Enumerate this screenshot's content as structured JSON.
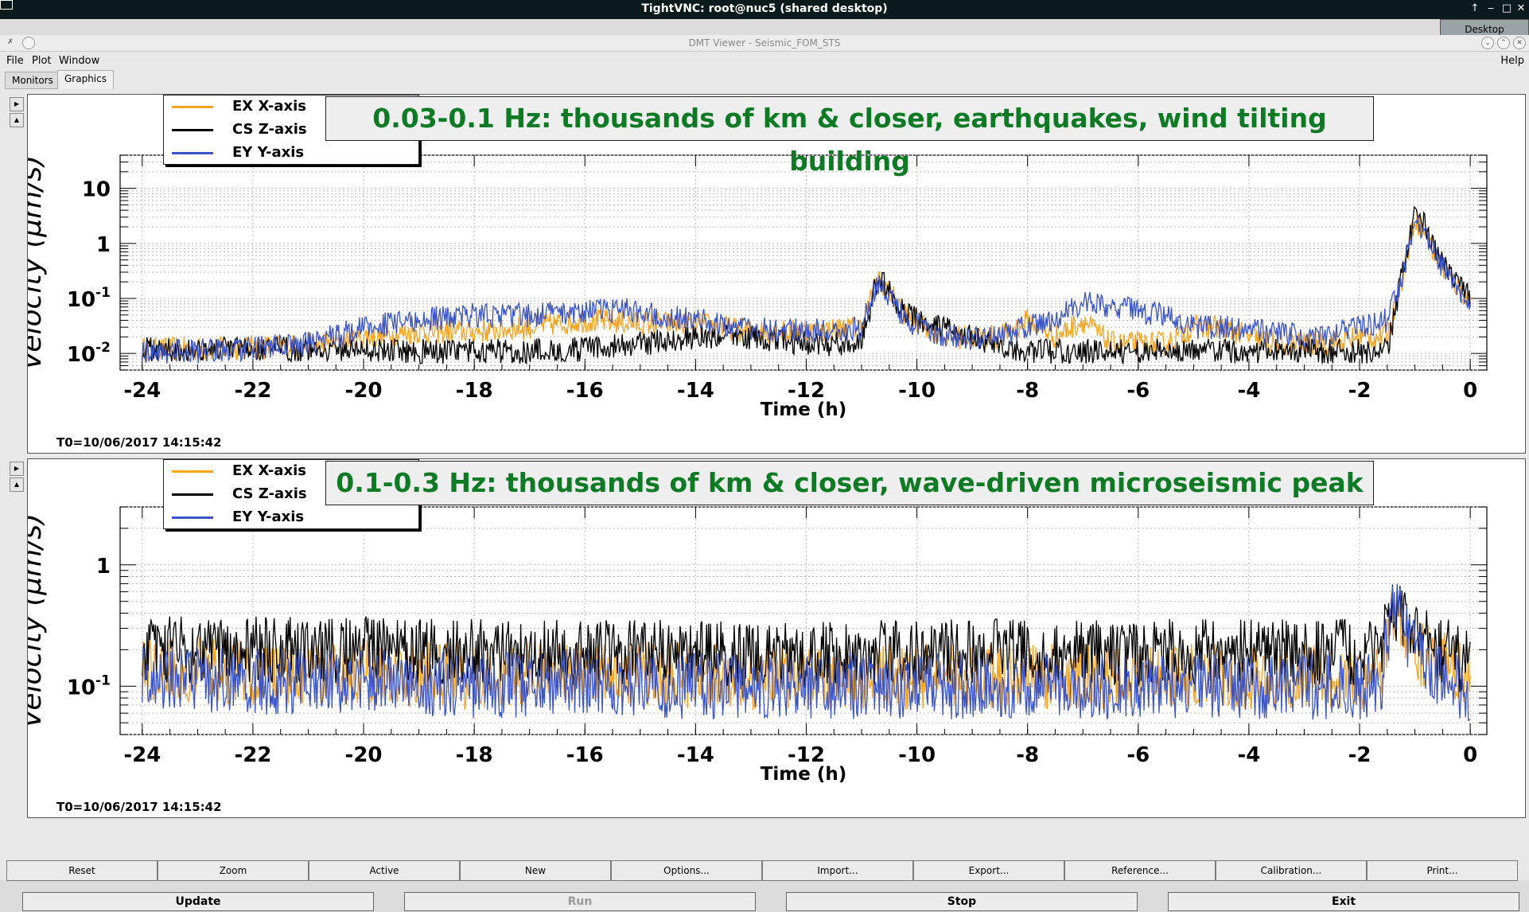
{
  "vnc": {
    "title": "TightVNC: root@nuc5 (shared desktop)",
    "desktop_tab": "Desktop"
  },
  "app": {
    "title": "DMT Viewer - Seismic_FOM_STS"
  },
  "menu": {
    "file": "File",
    "plot": "Plot",
    "window": "Window",
    "help": "Help"
  },
  "tabs": {
    "monitors": "Monitors",
    "graphics": "Graphics"
  },
  "legend": {
    "ex": "EX X-axis",
    "cs": "CS Z-axis",
    "ey": "EY Y-axis"
  },
  "colors": {
    "ex": "#f5a51c",
    "cs": "#000000",
    "ey": "#3b55c8",
    "title_green": "#0d7a24"
  },
  "plot1": {
    "title": "0.03-0.1 Hz: thousands of km & closer, earthquakes, wind tilting building",
    "t0": "T0=10/06/2017 14:15:42"
  },
  "plot2": {
    "title": "0.1-0.3 Hz: thousands of km & closer, wave-driven microseismic peak",
    "t0": "T0=10/06/2017 14:15:42"
  },
  "chart_data": [
    {
      "type": "line",
      "title": "0.03-0.1 Hz: thousands of km & closer, earthquakes, wind tilting building",
      "xlabel": "Time (h)",
      "ylabel": "Velocity  (μm/s)",
      "yscale": "log",
      "xlim": [
        -24.4,
        0.3
      ],
      "ylim": [
        0.005,
        40
      ],
      "xticks": [
        "-24",
        "-22",
        "-20",
        "-18",
        "-16",
        "-14",
        "-12",
        "-10",
        "-8",
        "-6",
        "-4",
        "-2",
        "0"
      ],
      "yticks": [
        {
          "v": 0.01,
          "base": "10",
          "exp": "-2"
        },
        {
          "v": 0.1,
          "base": "10",
          "exp": "-1"
        },
        {
          "v": 1,
          "base": "1",
          "exp": ""
        },
        {
          "v": 10,
          "base": "10",
          "exp": ""
        }
      ],
      "legend": "top-left",
      "grid": true,
      "series": [
        {
          "name": "EX X-axis",
          "color": "#f5a51c",
          "x": [
            -24,
            -23,
            -22,
            -21,
            -20,
            -19,
            -18,
            -17,
            -16,
            -15,
            -14,
            -13,
            -12,
            -11,
            -10.7,
            -10.2,
            -9.5,
            -9,
            -8.5,
            -8,
            -7.5,
            -7,
            -6.5,
            -6,
            -5.5,
            -5,
            -4.5,
            -4,
            -3.5,
            -3,
            -2.5,
            -2,
            -1.5,
            -1.2,
            -1,
            -0.8,
            -0.6,
            -0.3,
            0
          ],
          "y": [
            0.012,
            0.012,
            0.013,
            0.014,
            0.02,
            0.025,
            0.025,
            0.03,
            0.04,
            0.035,
            0.035,
            0.025,
            0.025,
            0.03,
            0.25,
            0.05,
            0.02,
            0.02,
            0.02,
            0.04,
            0.02,
            0.04,
            0.015,
            0.015,
            0.015,
            0.03,
            0.03,
            0.02,
            0.015,
            0.015,
            0.015,
            0.02,
            0.02,
            0.3,
            3,
            1.5,
            0.5,
            0.2,
            0.08
          ]
        },
        {
          "name": "CS Z-axis",
          "color": "#000000",
          "x": [
            -24,
            -23,
            -22,
            -21,
            -20,
            -19,
            -18,
            -17,
            -16,
            -15,
            -14,
            -13,
            -12,
            -11,
            -10.7,
            -10.2,
            -9.5,
            -9,
            -8.5,
            -8,
            -7.5,
            -7,
            -6.5,
            -6,
            -5.5,
            -5,
            -4.5,
            -4,
            -3.5,
            -3,
            -2.5,
            -2,
            -1.5,
            -1.2,
            -1,
            -0.8,
            -0.6,
            -0.3,
            0
          ],
          "y": [
            0.012,
            0.012,
            0.012,
            0.012,
            0.012,
            0.011,
            0.011,
            0.011,
            0.012,
            0.015,
            0.02,
            0.02,
            0.015,
            0.015,
            0.25,
            0.05,
            0.03,
            0.02,
            0.012,
            0.011,
            0.011,
            0.011,
            0.011,
            0.011,
            0.011,
            0.011,
            0.011,
            0.011,
            0.011,
            0.011,
            0.011,
            0.011,
            0.011,
            0.4,
            3.5,
            2,
            0.7,
            0.25,
            0.1
          ]
        },
        {
          "name": "EY Y-axis",
          "color": "#3b55c8",
          "x": [
            -24,
            -23,
            -22,
            -21,
            -20,
            -19,
            -18,
            -17,
            -16,
            -15,
            -14,
            -13,
            -12,
            -11,
            -10.7,
            -10.2,
            -9.5,
            -9,
            -8.5,
            -8,
            -7.5,
            -7,
            -6.5,
            -6,
            -5.5,
            -5,
            -4.5,
            -4,
            -3.5,
            -3,
            -2.5,
            -2,
            -1.5,
            -1.2,
            -1,
            -0.8,
            -0.6,
            -0.3,
            0
          ],
          "y": [
            0.011,
            0.011,
            0.012,
            0.015,
            0.03,
            0.04,
            0.05,
            0.05,
            0.06,
            0.06,
            0.04,
            0.03,
            0.025,
            0.03,
            0.2,
            0.04,
            0.02,
            0.02,
            0.02,
            0.03,
            0.04,
            0.09,
            0.07,
            0.06,
            0.05,
            0.03,
            0.03,
            0.025,
            0.025,
            0.02,
            0.025,
            0.03,
            0.04,
            0.3,
            3,
            1.5,
            0.5,
            0.2,
            0.08
          ]
        }
      ]
    },
    {
      "type": "line",
      "title": "0.1-0.3 Hz: thousands of km & closer, wave-driven microseismic peak",
      "xlabel": "Time (h)",
      "ylabel": "Velocity  (μm/s)",
      "yscale": "log",
      "xlim": [
        -24.4,
        0.3
      ],
      "ylim": [
        0.04,
        3
      ],
      "xticks": [
        "-24",
        "-22",
        "-20",
        "-18",
        "-16",
        "-14",
        "-12",
        "-10",
        "-8",
        "-6",
        "-4",
        "-2",
        "0"
      ],
      "yticks": [
        {
          "v": 0.1,
          "base": "10",
          "exp": "-1"
        },
        {
          "v": 1,
          "base": "1",
          "exp": ""
        }
      ],
      "legend": "top-left",
      "grid": true,
      "series": [
        {
          "name": "EX X-axis",
          "color": "#f5a51c",
          "x": [
            -24,
            -22,
            -20,
            -18,
            -16,
            -14,
            -12,
            -10,
            -8,
            -6,
            -4,
            -2,
            -1.6,
            -1.4,
            -1.2,
            -1,
            -0.5,
            0
          ],
          "y": [
            0.14,
            0.13,
            0.13,
            0.12,
            0.13,
            0.12,
            0.12,
            0.12,
            0.12,
            0.12,
            0.12,
            0.12,
            0.12,
            0.35,
            0.3,
            0.2,
            0.15,
            0.12
          ]
        },
        {
          "name": "CS Z-axis",
          "color": "#000000",
          "x": [
            -24,
            -22,
            -20,
            -18,
            -16,
            -14,
            -12,
            -10,
            -8,
            -6,
            -4,
            -2,
            -1.6,
            -1.4,
            -1.2,
            -1,
            -0.5,
            0
          ],
          "y": [
            0.2,
            0.2,
            0.2,
            0.19,
            0.19,
            0.19,
            0.18,
            0.19,
            0.19,
            0.19,
            0.19,
            0.19,
            0.2,
            0.45,
            0.35,
            0.25,
            0.2,
            0.15
          ]
        },
        {
          "name": "EY Y-axis",
          "color": "#3b55c8",
          "x": [
            -24,
            -22,
            -20,
            -18,
            -16,
            -14,
            -12,
            -10,
            -8,
            -6,
            -4,
            -2,
            -1.6,
            -1.4,
            -1.2,
            -1,
            -0.5,
            0
          ],
          "y": [
            0.12,
            0.11,
            0.11,
            0.1,
            0.11,
            0.1,
            0.1,
            0.1,
            0.1,
            0.1,
            0.1,
            0.1,
            0.11,
            0.5,
            0.3,
            0.2,
            0.12,
            0.08
          ]
        }
      ]
    }
  ],
  "buttons": [
    "Reset",
    "Zoom",
    "Active",
    "New",
    "Options...",
    "Import...",
    "Export...",
    "Reference...",
    "Calibration...",
    "Print..."
  ],
  "actions": {
    "update": "Update",
    "run": "Run",
    "stop": "Stop",
    "exit": "Exit"
  }
}
